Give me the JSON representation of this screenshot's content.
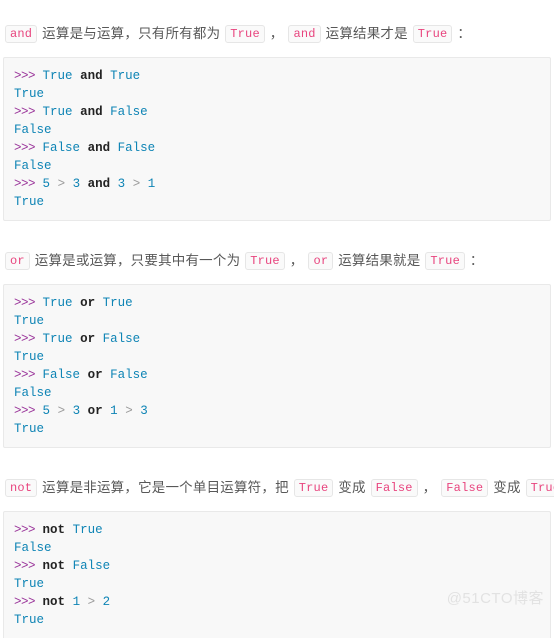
{
  "paragraphs": {
    "and": {
      "code1": "and",
      "text1": " 运算是与运算，只有所有都为 ",
      "code2": "True",
      "text2": " ， ",
      "code3": "and",
      "text3": " 运算结果才是 ",
      "code4": "True",
      "text4": " ："
    },
    "or": {
      "code1": "or",
      "text1": " 运算是或运算，只要其中有一个为 ",
      "code2": "True",
      "text2": " ， ",
      "code3": "or",
      "text3": " 运算结果就是 ",
      "code4": "True",
      "text4": " ："
    },
    "not": {
      "code1": "not",
      "text1": " 运算是非运算，它是一个单目运算符，把 ",
      "code2": "True",
      "text2": " 变成 ",
      "code3": "False",
      "text3": " ， ",
      "code4": "False",
      "text4": " 变成 ",
      "code5": "True",
      "text5": " ："
    }
  },
  "code_blocks": {
    "and_block": {
      "lines": [
        {
          "prompt": ">>>",
          "tokens": [
            {
              "t": "bool",
              "v": "True"
            },
            {
              "t": "kw",
              "v": "and"
            },
            {
              "t": "bool",
              "v": "True"
            }
          ]
        },
        {
          "prompt": "",
          "tokens": [
            {
              "t": "out",
              "v": "True"
            }
          ]
        },
        {
          "prompt": ">>>",
          "tokens": [
            {
              "t": "bool",
              "v": "True"
            },
            {
              "t": "kw",
              "v": "and"
            },
            {
              "t": "bool",
              "v": "False"
            }
          ]
        },
        {
          "prompt": "",
          "tokens": [
            {
              "t": "out",
              "v": "False"
            }
          ]
        },
        {
          "prompt": ">>>",
          "tokens": [
            {
              "t": "bool",
              "v": "False"
            },
            {
              "t": "kw",
              "v": "and"
            },
            {
              "t": "bool",
              "v": "False"
            }
          ]
        },
        {
          "prompt": "",
          "tokens": [
            {
              "t": "out",
              "v": "False"
            }
          ]
        },
        {
          "prompt": ">>>",
          "tokens": [
            {
              "t": "num",
              "v": "5"
            },
            {
              "t": "op",
              "v": ">"
            },
            {
              "t": "num",
              "v": "3"
            },
            {
              "t": "kw",
              "v": "and"
            },
            {
              "t": "num",
              "v": "3"
            },
            {
              "t": "op",
              "v": ">"
            },
            {
              "t": "num",
              "v": "1"
            }
          ]
        },
        {
          "prompt": "",
          "tokens": [
            {
              "t": "out",
              "v": "True"
            }
          ]
        }
      ]
    },
    "or_block": {
      "lines": [
        {
          "prompt": ">>>",
          "tokens": [
            {
              "t": "bool",
              "v": "True"
            },
            {
              "t": "kw",
              "v": "or"
            },
            {
              "t": "bool",
              "v": "True"
            }
          ]
        },
        {
          "prompt": "",
          "tokens": [
            {
              "t": "out",
              "v": "True"
            }
          ]
        },
        {
          "prompt": ">>>",
          "tokens": [
            {
              "t": "bool",
              "v": "True"
            },
            {
              "t": "kw",
              "v": "or"
            },
            {
              "t": "bool",
              "v": "False"
            }
          ]
        },
        {
          "prompt": "",
          "tokens": [
            {
              "t": "out",
              "v": "True"
            }
          ]
        },
        {
          "prompt": ">>>",
          "tokens": [
            {
              "t": "bool",
              "v": "False"
            },
            {
              "t": "kw",
              "v": "or"
            },
            {
              "t": "bool",
              "v": "False"
            }
          ]
        },
        {
          "prompt": "",
          "tokens": [
            {
              "t": "out",
              "v": "False"
            }
          ]
        },
        {
          "prompt": ">>>",
          "tokens": [
            {
              "t": "num",
              "v": "5"
            },
            {
              "t": "op",
              "v": ">"
            },
            {
              "t": "num",
              "v": "3"
            },
            {
              "t": "kw",
              "v": "or"
            },
            {
              "t": "num",
              "v": "1"
            },
            {
              "t": "op",
              "v": ">"
            },
            {
              "t": "num",
              "v": "3"
            }
          ]
        },
        {
          "prompt": "",
          "tokens": [
            {
              "t": "out",
              "v": "True"
            }
          ]
        }
      ]
    },
    "not_block": {
      "lines": [
        {
          "prompt": ">>>",
          "tokens": [
            {
              "t": "kw",
              "v": "not"
            },
            {
              "t": "bool",
              "v": "True"
            }
          ]
        },
        {
          "prompt": "",
          "tokens": [
            {
              "t": "out",
              "v": "False"
            }
          ]
        },
        {
          "prompt": ">>>",
          "tokens": [
            {
              "t": "kw",
              "v": "not"
            },
            {
              "t": "bool",
              "v": "False"
            }
          ]
        },
        {
          "prompt": "",
          "tokens": [
            {
              "t": "out",
              "v": "True"
            }
          ]
        },
        {
          "prompt": ">>>",
          "tokens": [
            {
              "t": "kw",
              "v": "not"
            },
            {
              "t": "num",
              "v": "1"
            },
            {
              "t": "op",
              "v": ">"
            },
            {
              "t": "num",
              "v": "2"
            }
          ]
        },
        {
          "prompt": "",
          "tokens": [
            {
              "t": "out",
              "v": "True"
            }
          ]
        }
      ]
    }
  },
  "watermark": {
    "text": "@51CTO博客"
  },
  "colors": {
    "prompt": "#993399",
    "keyword": "#222222",
    "boolean": "#0e84b5",
    "number": "#0e84b5",
    "operator": "#9a9a9a",
    "inline_code_text": "#e8447e",
    "inline_code_bg": "#fafafa",
    "code_block_bg": "#f8f8f8",
    "body_text": "#5a5a5a",
    "watermark": "#e2e2e2"
  }
}
